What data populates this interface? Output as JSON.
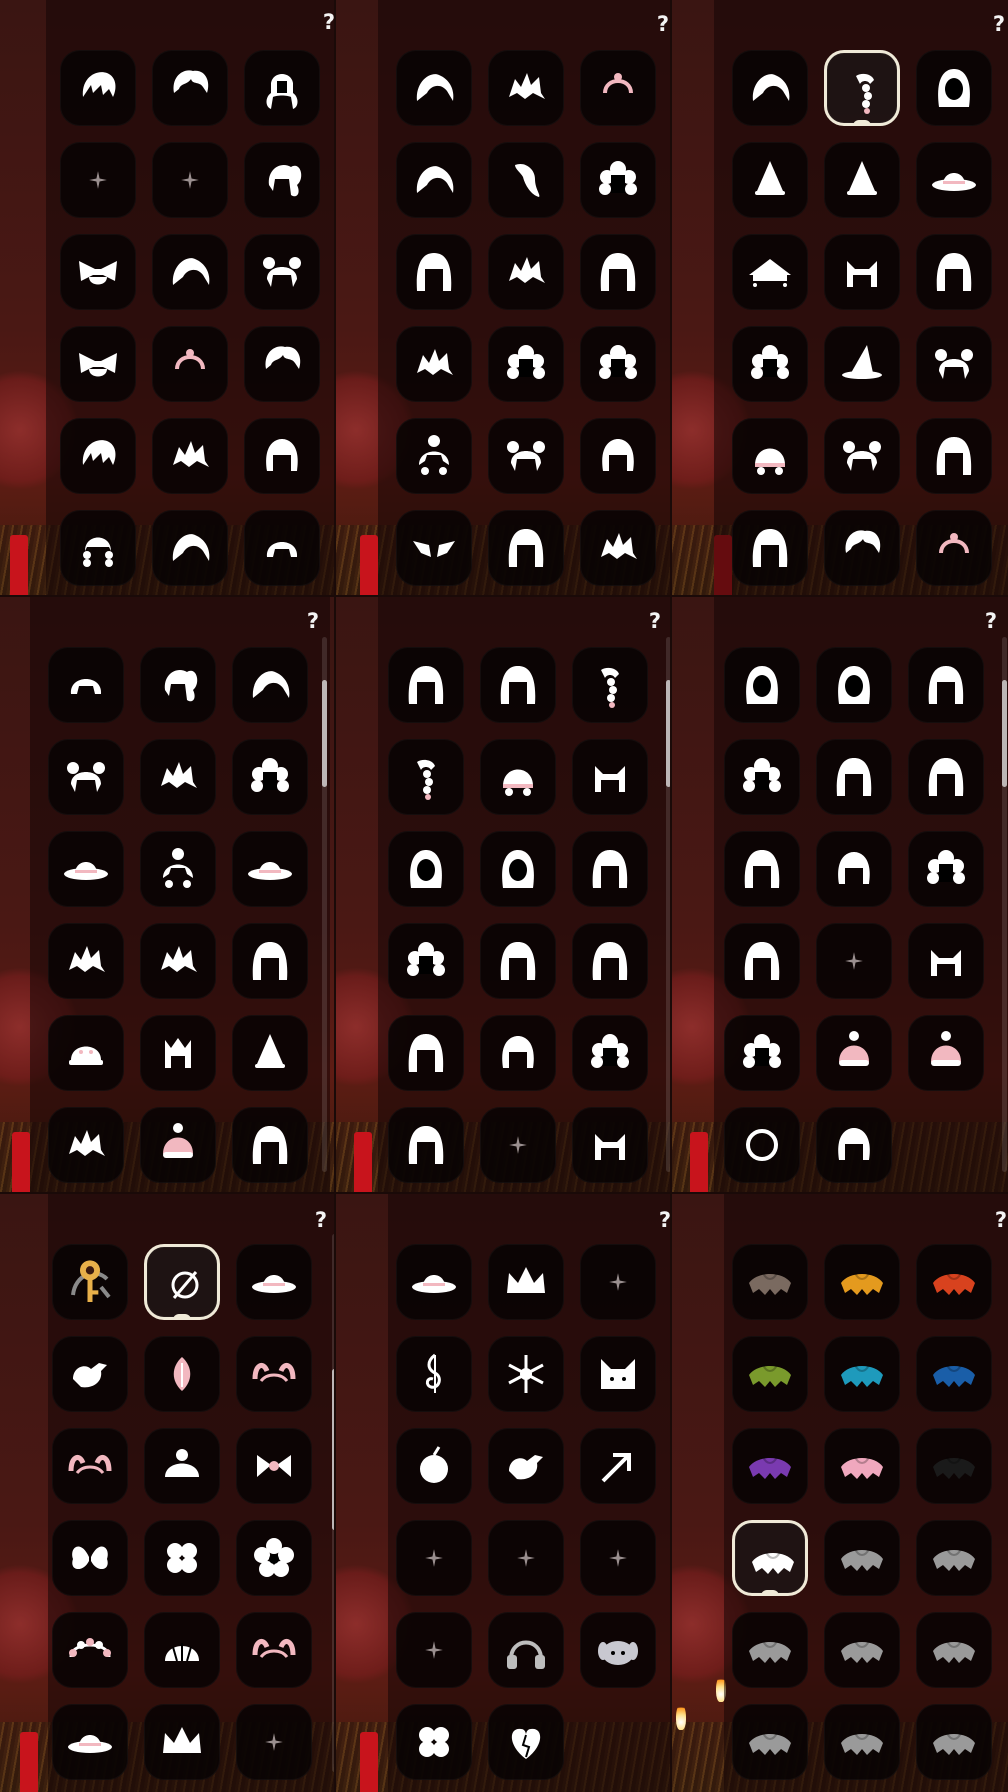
{
  "help_label": "?",
  "colors": {
    "accent": "#f0ead8",
    "pink": "#f2b8c0",
    "sheet": "#1a0808"
  },
  "panels": [
    {
      "tiles": [
        [
          "hair-bangs-icon",
          "hair-short-icon",
          "hair-pigtails-icon"
        ],
        [
          "sparkle-icon",
          "sparkle-icon",
          "hair-ponytail-icon"
        ],
        [
          "hair-bow-icon",
          "hair-swept-icon",
          "hair-buns-icon"
        ],
        [
          "hair-bow-icon",
          "headband-icon",
          "hair-short-icon"
        ],
        [
          "hair-bangs-icon",
          "hair-spiky-icon",
          "hair-bob-icon"
        ],
        [
          "hair-braids-icon",
          "hair-swept-icon",
          "hair-bowl-icon"
        ]
      ],
      "selected": null
    },
    {
      "tiles": [
        [
          "hair-swept-icon",
          "hair-spiky-icon",
          "headband-icon"
        ],
        [
          "hair-swept-icon",
          "hair-fringe-icon",
          "hair-curly-icon"
        ],
        [
          "hair-long-icon",
          "hair-spiky-icon",
          "hair-long-icon"
        ],
        [
          "hair-spiky-icon",
          "hair-curly-icon",
          "hair-curly-icon"
        ],
        [
          "hair-bun-icon",
          "hair-buns-icon",
          "hair-bob-icon"
        ],
        [
          "hair-wings-icon",
          "hair-long-icon",
          "hair-spiky-icon"
        ]
      ],
      "selected": null
    },
    {
      "tiles": [
        [
          "hair-swept-icon",
          "hair-braid-icon",
          "hood-icon"
        ],
        [
          "hat-cone-icon",
          "hat-cone-icon",
          "hat-brim-icon"
        ],
        [
          "hat-lamp-icon",
          "hair-cat-icon",
          "hair-long-icon"
        ],
        [
          "hair-curly-icon",
          "hat-witch-icon",
          "hair-buns-icon"
        ],
        [
          "hat-helmet-icon",
          "hair-buns-icon",
          "hair-long-icon"
        ],
        [
          "hair-long-icon",
          "hair-short-icon",
          "headband-icon"
        ]
      ],
      "selected": [
        0,
        1
      ]
    },
    {
      "tiles": [
        [
          "hair-bowl-icon",
          "hair-ponytail-icon",
          "hair-swept-icon"
        ],
        [
          "hair-buns-icon",
          "hair-spiky-icon",
          "hair-curly-icon"
        ],
        [
          "hat-brim-icon",
          "hair-bun-icon",
          "hat-brim-icon"
        ],
        [
          "hair-spiky-icon",
          "hair-spiky-icon",
          "hair-long-icon"
        ],
        [
          "hat-cap-icon",
          "hat-crown-icon",
          "hat-cone-icon"
        ],
        [
          "hair-spiky-icon",
          "hat-knit-icon",
          "hair-long-icon"
        ]
      ],
      "selected": null,
      "scroll": [
        0.08,
        0.28
      ]
    },
    {
      "tiles": [
        [
          "hair-long-icon",
          "hair-long-icon",
          "hair-braid-icon"
        ],
        [
          "hair-braid-icon",
          "hat-helmet-icon",
          "hair-cat-icon"
        ],
        [
          "hood-icon",
          "hood-icon",
          "hair-long-icon"
        ],
        [
          "hair-curly-icon",
          "hair-long-icon",
          "hair-long-icon"
        ],
        [
          "hair-long-icon",
          "hair-bob-icon",
          "hair-curly-icon"
        ],
        [
          "hair-long-icon",
          "sparkle-icon",
          "hair-cat-icon"
        ]
      ],
      "selected": null,
      "scroll": [
        0.08,
        0.28
      ]
    },
    {
      "tiles": [
        [
          "hood-icon",
          "hood-icon",
          "hair-long-icon"
        ],
        [
          "hair-curly-icon",
          "hair-long-icon",
          "hair-long-icon"
        ],
        [
          "hair-long-icon",
          "hair-bob-icon",
          "hair-curly-icon"
        ],
        [
          "hair-long-icon",
          "sparkle-icon",
          "hair-cat-icon"
        ],
        [
          "hair-curly-icon",
          "hat-knit-icon",
          "hat-knit-icon"
        ],
        [
          "ring-icon",
          "hair-bob-icon",
          null
        ]
      ],
      "selected": null,
      "scroll": [
        0.08,
        0.28
      ]
    },
    {
      "tiles": [
        [
          "tool-icon",
          "none-icon",
          "hat-brim-icon"
        ],
        [
          "bird-icon",
          "petal-icon",
          "antlers-icon"
        ],
        [
          "antlers-icon",
          "hat-bun-icon",
          "bow-icon"
        ],
        [
          "butterfly-icon",
          "clover-icon",
          "flower-icon"
        ],
        [
          "crown-flower-icon",
          "shell-icon",
          "antlers-icon"
        ],
        [
          "hat-brim-icon",
          "crown-icon",
          "sparkle-icon"
        ]
      ],
      "selected": [
        0,
        1
      ],
      "scroll": [
        0.25,
        0.55
      ]
    },
    {
      "tiles": [
        [
          "hat-brim-icon",
          "crown-icon",
          "sparkle-icon"
        ],
        [
          "clef-icon",
          "snowflake-icon",
          "cat-face-icon"
        ],
        [
          "apple-icon",
          "bird-icon",
          "arrow-icon"
        ],
        [
          "sparkle-icon",
          "sparkle-icon",
          "sparkle-icon"
        ],
        [
          "sparkle-icon",
          "headphones-icon",
          "puppy-icon"
        ],
        [
          "clover-icon",
          "heart-icon",
          null
        ]
      ],
      "selected": null
    },
    {
      "tiles": [
        [
          "cape-brown-icon",
          "cape-orange-icon",
          "cape-red-icon"
        ],
        [
          "cape-green-icon",
          "cape-teal-icon",
          "cape-blue-icon"
        ],
        [
          "cape-purple-icon",
          "cape-pink-icon",
          "cape-black-icon"
        ],
        [
          "cape-white-icon",
          "cape-grey-icon",
          "cape-grey-icon"
        ],
        [
          "cape-grey-icon",
          "cape-grey-icon",
          "cape-grey-icon"
        ],
        [
          "cape-grey-icon",
          "cape-grey-icon",
          "cape-grey-icon"
        ]
      ],
      "selected": [
        3,
        0
      ]
    }
  ]
}
